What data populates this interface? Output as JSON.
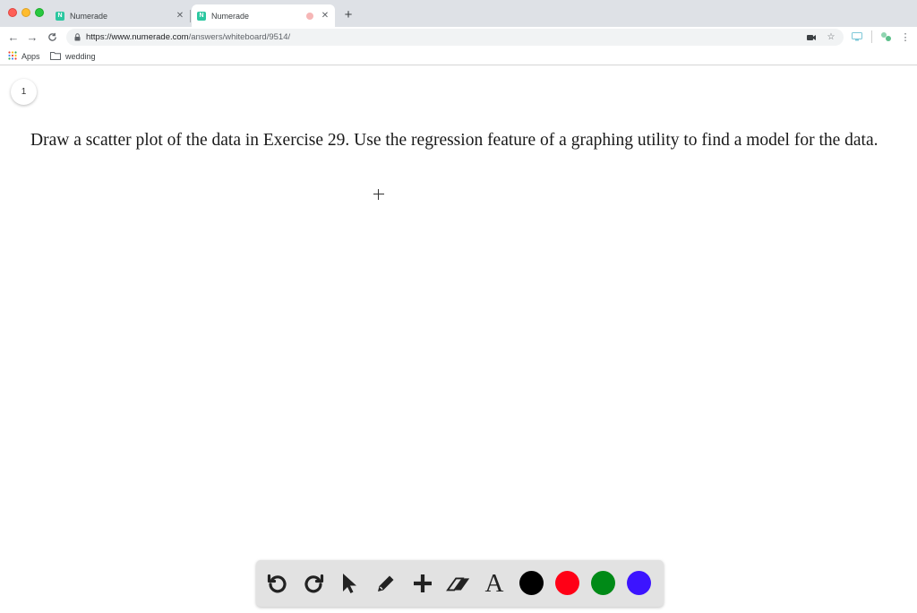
{
  "browser": {
    "tabs": [
      {
        "title": "Numerade",
        "favicon_letter": "N",
        "active": false
      },
      {
        "title": "Numerade",
        "favicon_letter": "N",
        "active": true
      }
    ],
    "new_tab_icon": "plus-icon",
    "url_host": "https://www.numerade.com",
    "url_path": "/answers/whiteboard/9514/",
    "bookmarks": [
      {
        "label": "Apps",
        "icon": "apps-grid-icon"
      },
      {
        "label": "wedding",
        "icon": "folder-icon"
      }
    ]
  },
  "page": {
    "page_number": "1",
    "question": "Draw a scatter plot of the data in Exercise 29. Use the regression feature of a graphing utility to find a model for the data."
  },
  "drawing_toolbar": {
    "tools": [
      "undo-icon",
      "redo-icon",
      "select-pointer-icon",
      "pencil-icon",
      "plus-icon",
      "eraser-icon",
      "text-icon"
    ],
    "text_tool_label": "A",
    "colors": [
      "#000000",
      "#ff0016",
      "#008a17",
      "#3c14ff"
    ]
  }
}
